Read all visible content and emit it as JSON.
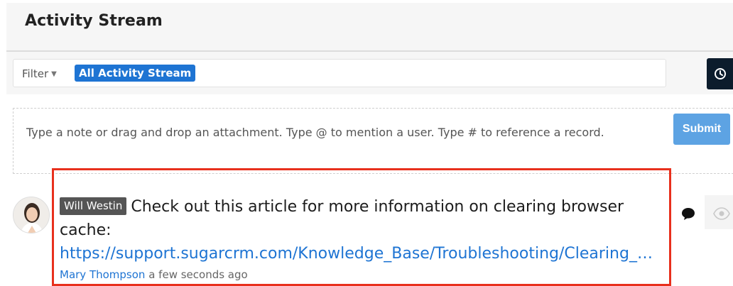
{
  "header": {
    "title": "Activity Stream"
  },
  "filter": {
    "label": "Filter",
    "active_filter": "All Activity Stream"
  },
  "composer": {
    "placeholder": "Type a note or drag and drop an attachment. Type @ to mention a user. Type # to reference a record.",
    "submit_label": "Submit"
  },
  "post": {
    "author_tag": "Will Westin",
    "text": "Check out this article for more information on clearing browser cache:",
    "link": "https://support.sugarcrm.com/Knowledge_Base/Troubleshooting/Clearing_…",
    "posted_by": "Mary Thompson",
    "time": "a few seconds ago"
  },
  "icons": {
    "toggle": "clock-icon",
    "comment": "comment-icon",
    "preview": "eye-icon",
    "caret": "caret-down-icon"
  },
  "colors": {
    "accent": "#1e74d3",
    "submit": "#5da3e3",
    "highlight": "#e8301d",
    "dark": "#0c1c2c"
  }
}
